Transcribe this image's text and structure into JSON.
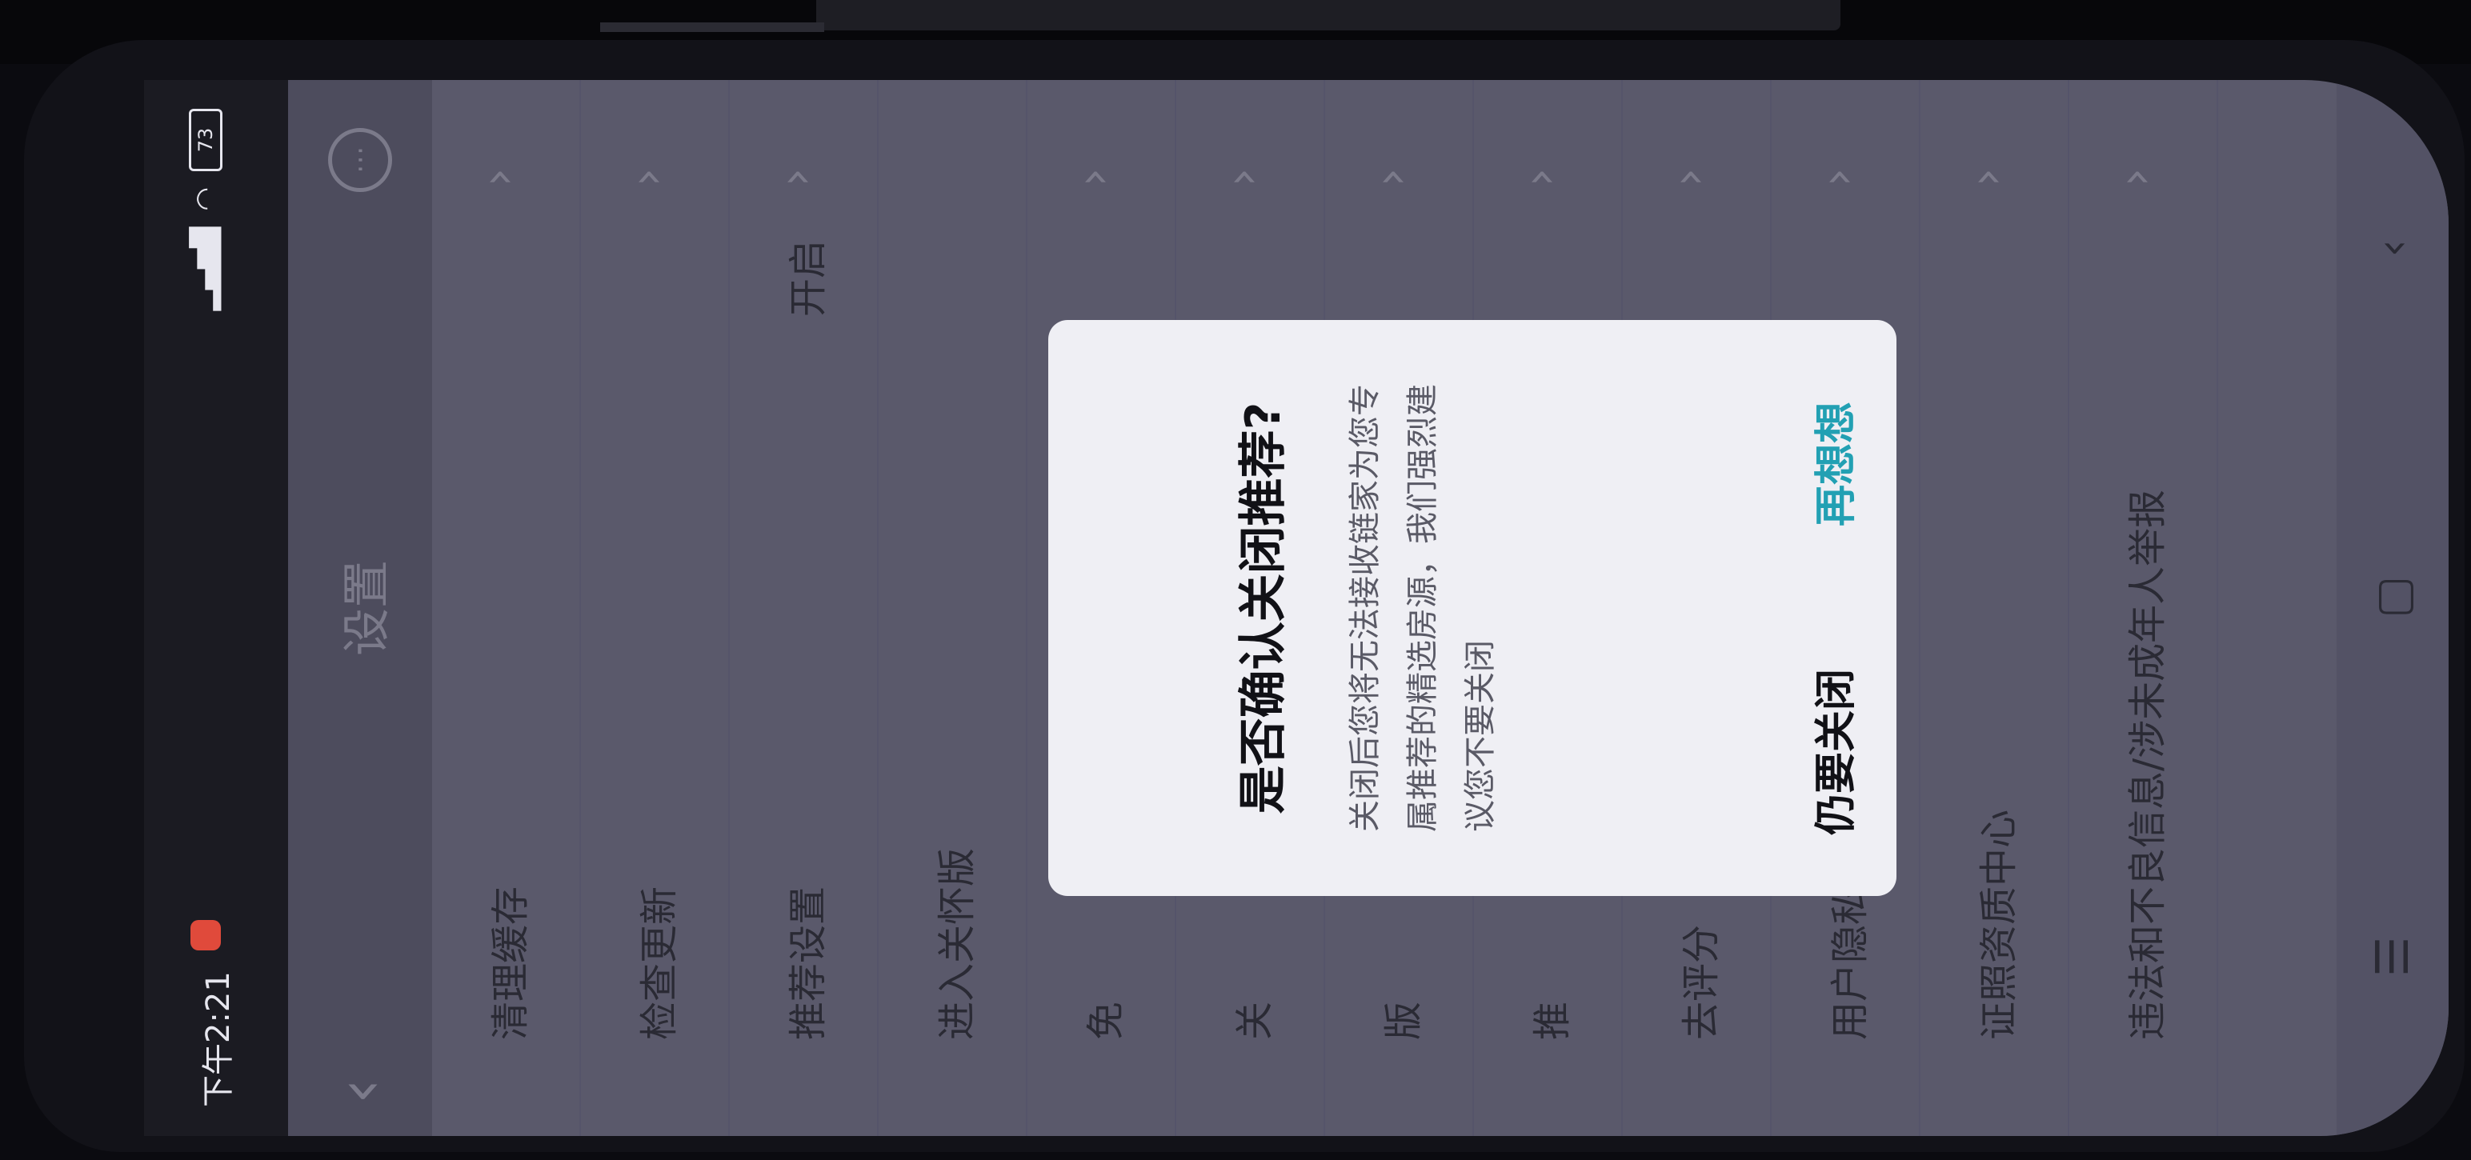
{
  "status_bar": {
    "time": "下午2:21",
    "battery": "73"
  },
  "header": {
    "title": "设置"
  },
  "settings": {
    "items": [
      {
        "label": "清理缓存",
        "value": ""
      },
      {
        "label": "检查更新",
        "value": ""
      },
      {
        "label": "推荐设置",
        "value": "开启"
      },
      {
        "label": "进入关怀版",
        "value": ""
      },
      {
        "label": "免",
        "value": ""
      },
      {
        "label": "关",
        "value": ""
      },
      {
        "label": "版",
        "value": ""
      },
      {
        "label": "推",
        "value": ""
      },
      {
        "label": "去评分",
        "value": ""
      },
      {
        "label": "用户隐私与规则中心",
        "value": ""
      },
      {
        "label": "证照资质中心",
        "value": ""
      },
      {
        "label": "违法和不良信息/涉未成年人举报",
        "value": ""
      }
    ]
  },
  "dialog": {
    "title": "是否确认关闭推荐?",
    "message": "关闭后您将无法接收链家为您专属推荐的精选房源，我们强烈建议您不要关闭",
    "cancel_label": "仍要关闭",
    "confirm_label": "再想想"
  },
  "nav": {
    "recents_icon": "recents-icon",
    "home_icon": "home-icon",
    "back_icon": "back-icon"
  },
  "colors": {
    "accent": "#22a0b3",
    "dim_background": "#5a596b",
    "dialog_background": "#efeff4"
  }
}
